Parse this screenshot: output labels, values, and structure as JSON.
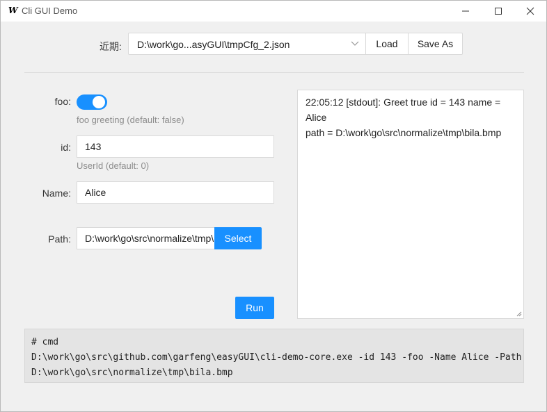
{
  "window": {
    "title": "Cli GUI Demo",
    "icon_glyph": "W",
    "controls": [
      "minimize-icon",
      "maximize-icon",
      "close-icon"
    ]
  },
  "toolbar": {
    "recent_label": "近期:",
    "config_file": "D:\\work\\go...asyGUI\\tmpCfg_2.json",
    "load_label": "Load",
    "save_as_label": "Save As"
  },
  "form": {
    "foo": {
      "label": "foo:",
      "value": true,
      "hint": "foo greeting (default: false)"
    },
    "id": {
      "label": "id:",
      "value": "143",
      "hint": "UserId (default: 0)"
    },
    "name": {
      "label": "Name:",
      "value": "Alice"
    },
    "path": {
      "label": "Path:",
      "value": "D:\\work\\go\\src\\normalize\\tmp\\bila.bmp",
      "select_label": "Select"
    },
    "run_label": "Run"
  },
  "output": {
    "lines": [
      "22:05:12 [stdout]: Greet true id = 143 name = Alice",
      "path = D:\\work\\go\\src\\normalize\\tmp\\bila.bmp"
    ]
  },
  "cmd": {
    "lines": [
      "# cmd",
      "D:\\work\\go\\src\\github.com\\garfeng\\easyGUI\\cli-demo-core.exe -id 143 -foo -Name Alice -Path",
      "D:\\work\\go\\src\\normalize\\tmp\\bila.bmp"
    ]
  },
  "colors": {
    "accent": "#1890ff"
  }
}
